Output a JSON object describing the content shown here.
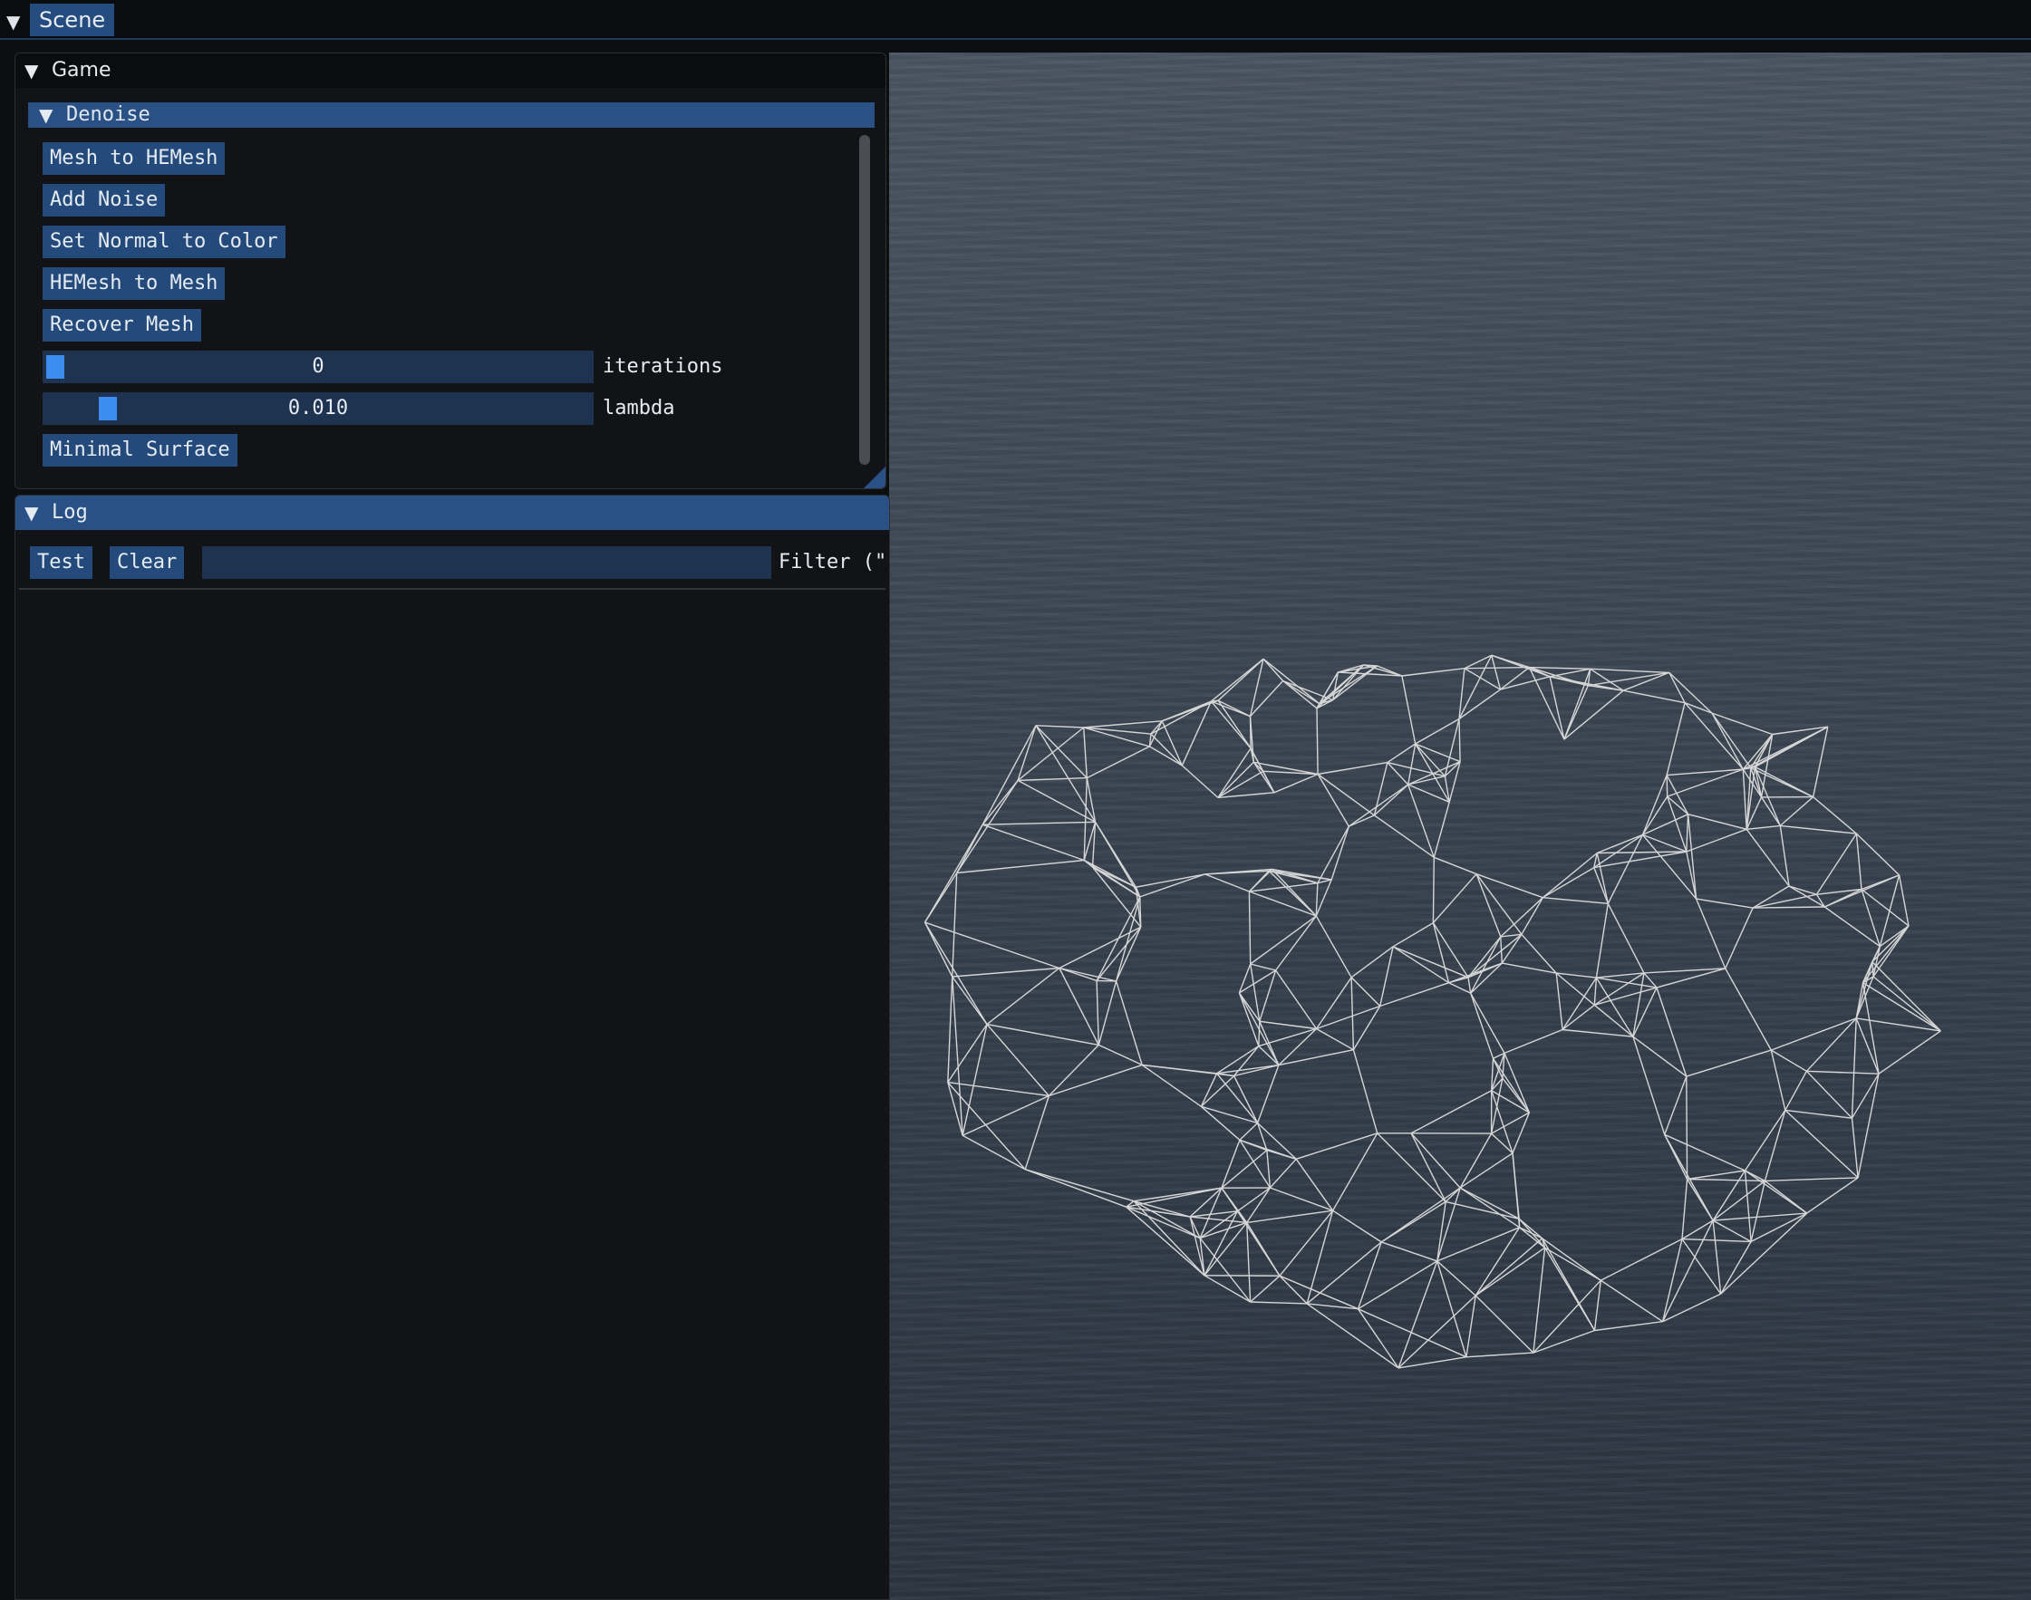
{
  "menubar": {
    "tab_label": "Scene"
  },
  "game_window": {
    "title": "Game",
    "section": {
      "title": "Denoise",
      "buttons": [
        "Mesh to HEMesh",
        "Add Noise",
        "Set Normal to Color",
        "HEMesh to Mesh",
        "Recover Mesh",
        "Minimal Surface"
      ],
      "sliders": [
        {
          "label": "iterations",
          "value": "0",
          "fraction": 0.0
        },
        {
          "label": "lambda",
          "value": "0.010",
          "fraction": 0.1
        }
      ]
    }
  },
  "log_window": {
    "title": "Log",
    "test_label": "Test",
    "clear_label": "Clear",
    "filter_value": "",
    "filter_label": "Filter (\""
  },
  "viewport": {
    "object": "wireframe mesh",
    "wire_color": "#d6d6d6",
    "background": "#3c4653"
  },
  "colors": {
    "header": "#2a5185",
    "button": "#234a7a",
    "slider_bg": "#1e3350",
    "grab": "#3d8cf0",
    "window_bg": "#121316"
  }
}
